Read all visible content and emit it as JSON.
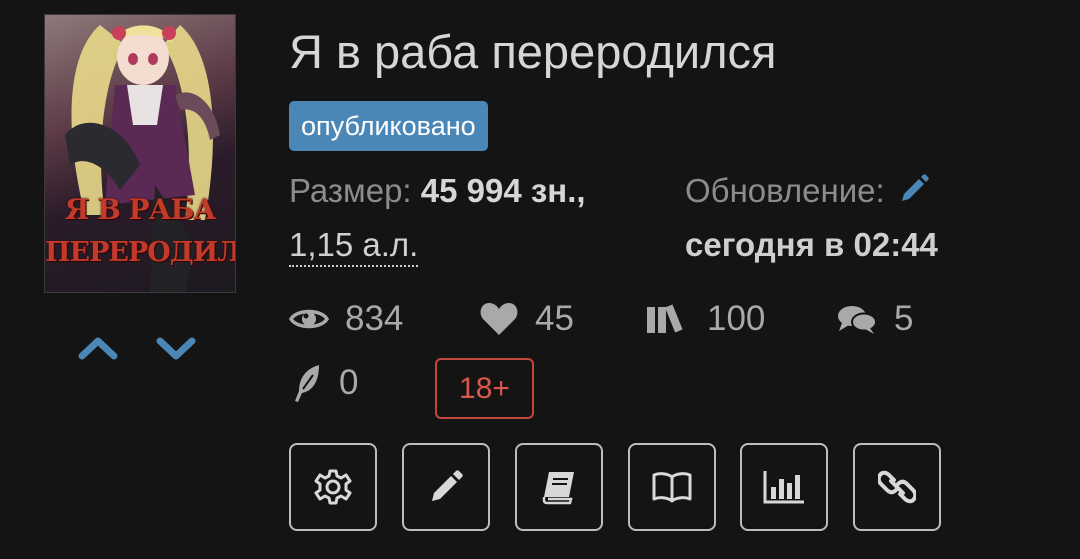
{
  "book": {
    "title": "Я в раба переродился",
    "status_badge": "опубликовано",
    "cover": {
      "title_line1": "Я В РАБА",
      "title_line2": "ПЕРЕРОДИЛСЯ"
    },
    "size": {
      "label": "Размер:",
      "chars": "45 994 зн.,",
      "sheets": "1,15 а.л."
    },
    "update": {
      "label": "Обновление:",
      "value": "сегодня в 02:44"
    },
    "stats": {
      "views": "834",
      "likes": "45",
      "library": "100",
      "comments": "5",
      "reviews": "0"
    },
    "age_rating": "18+"
  },
  "colors": {
    "background": "#141414",
    "accent_blue": "#4a87b7",
    "age_red": "#c2473c",
    "text": "#d6d6d6",
    "muted": "#8c8c8c"
  },
  "icons": {
    "vote_up": "chevron-up-icon",
    "vote_down": "chevron-down-icon",
    "edit_update": "pencil-icon",
    "views": "eye-icon",
    "likes": "heart-icon",
    "library": "books-icon",
    "comments": "comments-icon",
    "reviews": "feather-icon",
    "actions": [
      "gear-icon",
      "pencil-icon",
      "book-icon",
      "open-book-icon",
      "bar-chart-icon",
      "link-icon"
    ]
  }
}
